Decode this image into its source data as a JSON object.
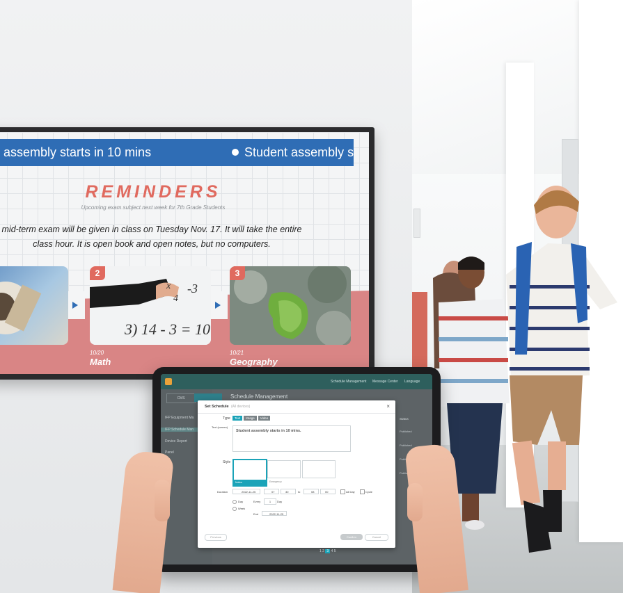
{
  "tv": {
    "ticker_text_1": "assembly starts in 10 mins",
    "ticker_text_2": "Student assembly sta",
    "title": "REMINDERS",
    "subtitle": "Upcoming exam subject next week for 7th Grade Students",
    "body_line_1": "mid-term exam will be given in class on Tuesday Nov. 17. It will take the entire",
    "body_line_2": "class hour. It is open book and open notes, but no computers.",
    "cards": [
      {
        "num": "2",
        "date": "10/20",
        "subject": "Math"
      },
      {
        "num": "3",
        "date": "10/21",
        "subject": "Geography"
      }
    ],
    "board_text_1": "x",
    "board_text_2": "-3",
    "board_text_3": "4",
    "board_text_4": "3) 14 - 3 = 10"
  },
  "tablet": {
    "top_right": [
      "Schedule Management",
      "Message Center",
      "Language"
    ],
    "side_items": [
      "IFP Equipment Ma",
      "IFP Schedule Man",
      "Device Report",
      "Panel"
    ],
    "tabs": [
      "CMS",
      ""
    ],
    "bg_title": "Schedule Management",
    "modal": {
      "title": "Set Schedule",
      "title_note": "(All devices)",
      "close": "×",
      "type_label": "Type",
      "type_options": [
        "Text",
        "Image",
        "Video"
      ],
      "text_label": "Text (screen)",
      "text_value": "Student assembly starts in 10 mins.",
      "style_label": "Style",
      "style_options": [
        "Notice",
        "Emergency",
        ""
      ],
      "duration_label": "Duration",
      "date_start": "2022-11-25",
      "time_h": "07",
      "time_m": "30",
      "to": "to",
      "time_h2": "08",
      "time_m2": "00",
      "allday": "All Day",
      "cycle": "Cycle",
      "day": "Day",
      "week": "Week",
      "every": "Every",
      "every_val": "1",
      "every_unit": "Day",
      "end_label": "End",
      "end_date": "2022-11-25",
      "prev_btn": "Previous",
      "confirm_btn": "Confirm",
      "cancel_btn": "Cancel"
    },
    "status_col": "Status",
    "status_items": [
      "Published",
      "Published",
      "Published",
      "Published"
    ],
    "pager": [
      "1",
      "2",
      "3",
      "4",
      "5"
    ]
  },
  "colors": {
    "ticker": "#2f6db5",
    "accent": "#e06a5f",
    "pink": "#d98585",
    "teal": "#2e5f5d",
    "tab_on": "#1aa3b8"
  }
}
